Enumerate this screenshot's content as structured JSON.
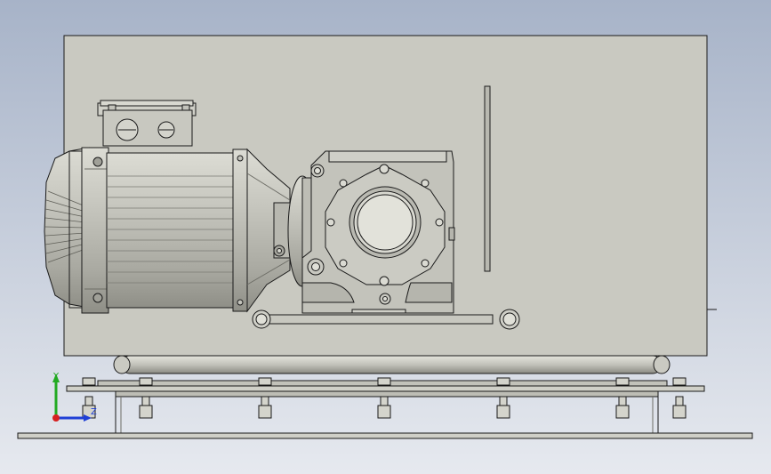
{
  "viewport": {
    "background_top": "#a7b3c8",
    "background_bottom": "#e6e9ef"
  },
  "model": {
    "panel_color": "#c9c9c1",
    "part_color": "#c3c3bb",
    "edge_color": "#1a1a1a",
    "shade_color": "#8e8e86",
    "highlight_color": "#e2e2da"
  },
  "triad": {
    "y_label": "Y",
    "z_label": "Z",
    "y_color": "#22aa22",
    "x_color": "#1f3fd6",
    "z_color": "#d62020"
  }
}
